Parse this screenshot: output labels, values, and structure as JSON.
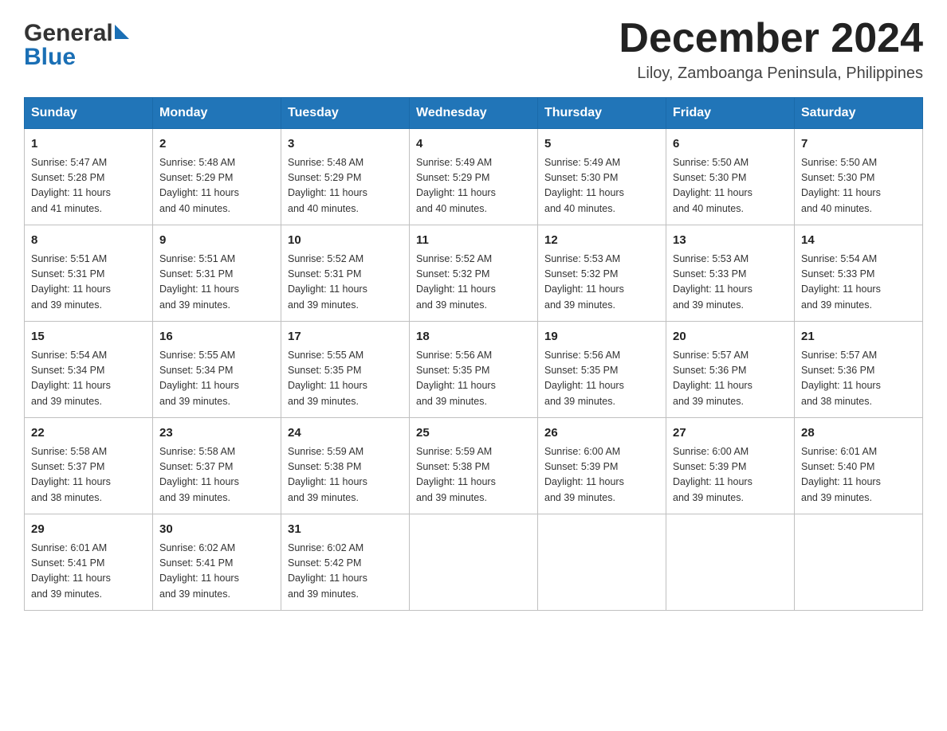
{
  "header": {
    "logo_general": "General",
    "logo_blue": "Blue",
    "month_title": "December 2024",
    "location": "Liloy, Zamboanga Peninsula, Philippines"
  },
  "days_of_week": [
    "Sunday",
    "Monday",
    "Tuesday",
    "Wednesday",
    "Thursday",
    "Friday",
    "Saturday"
  ],
  "weeks": [
    [
      {
        "day": "1",
        "sunrise": "5:47 AM",
        "sunset": "5:28 PM",
        "daylight": "11 hours and 41 minutes."
      },
      {
        "day": "2",
        "sunrise": "5:48 AM",
        "sunset": "5:29 PM",
        "daylight": "11 hours and 40 minutes."
      },
      {
        "day": "3",
        "sunrise": "5:48 AM",
        "sunset": "5:29 PM",
        "daylight": "11 hours and 40 minutes."
      },
      {
        "day": "4",
        "sunrise": "5:49 AM",
        "sunset": "5:29 PM",
        "daylight": "11 hours and 40 minutes."
      },
      {
        "day": "5",
        "sunrise": "5:49 AM",
        "sunset": "5:30 PM",
        "daylight": "11 hours and 40 minutes."
      },
      {
        "day": "6",
        "sunrise": "5:50 AM",
        "sunset": "5:30 PM",
        "daylight": "11 hours and 40 minutes."
      },
      {
        "day": "7",
        "sunrise": "5:50 AM",
        "sunset": "5:30 PM",
        "daylight": "11 hours and 40 minutes."
      }
    ],
    [
      {
        "day": "8",
        "sunrise": "5:51 AM",
        "sunset": "5:31 PM",
        "daylight": "11 hours and 39 minutes."
      },
      {
        "day": "9",
        "sunrise": "5:51 AM",
        "sunset": "5:31 PM",
        "daylight": "11 hours and 39 minutes."
      },
      {
        "day": "10",
        "sunrise": "5:52 AM",
        "sunset": "5:31 PM",
        "daylight": "11 hours and 39 minutes."
      },
      {
        "day": "11",
        "sunrise": "5:52 AM",
        "sunset": "5:32 PM",
        "daylight": "11 hours and 39 minutes."
      },
      {
        "day": "12",
        "sunrise": "5:53 AM",
        "sunset": "5:32 PM",
        "daylight": "11 hours and 39 minutes."
      },
      {
        "day": "13",
        "sunrise": "5:53 AM",
        "sunset": "5:33 PM",
        "daylight": "11 hours and 39 minutes."
      },
      {
        "day": "14",
        "sunrise": "5:54 AM",
        "sunset": "5:33 PM",
        "daylight": "11 hours and 39 minutes."
      }
    ],
    [
      {
        "day": "15",
        "sunrise": "5:54 AM",
        "sunset": "5:34 PM",
        "daylight": "11 hours and 39 minutes."
      },
      {
        "day": "16",
        "sunrise": "5:55 AM",
        "sunset": "5:34 PM",
        "daylight": "11 hours and 39 minutes."
      },
      {
        "day": "17",
        "sunrise": "5:55 AM",
        "sunset": "5:35 PM",
        "daylight": "11 hours and 39 minutes."
      },
      {
        "day": "18",
        "sunrise": "5:56 AM",
        "sunset": "5:35 PM",
        "daylight": "11 hours and 39 minutes."
      },
      {
        "day": "19",
        "sunrise": "5:56 AM",
        "sunset": "5:35 PM",
        "daylight": "11 hours and 39 minutes."
      },
      {
        "day": "20",
        "sunrise": "5:57 AM",
        "sunset": "5:36 PM",
        "daylight": "11 hours and 39 minutes."
      },
      {
        "day": "21",
        "sunrise": "5:57 AM",
        "sunset": "5:36 PM",
        "daylight": "11 hours and 38 minutes."
      }
    ],
    [
      {
        "day": "22",
        "sunrise": "5:58 AM",
        "sunset": "5:37 PM",
        "daylight": "11 hours and 38 minutes."
      },
      {
        "day": "23",
        "sunrise": "5:58 AM",
        "sunset": "5:37 PM",
        "daylight": "11 hours and 39 minutes."
      },
      {
        "day": "24",
        "sunrise": "5:59 AM",
        "sunset": "5:38 PM",
        "daylight": "11 hours and 39 minutes."
      },
      {
        "day": "25",
        "sunrise": "5:59 AM",
        "sunset": "5:38 PM",
        "daylight": "11 hours and 39 minutes."
      },
      {
        "day": "26",
        "sunrise": "6:00 AM",
        "sunset": "5:39 PM",
        "daylight": "11 hours and 39 minutes."
      },
      {
        "day": "27",
        "sunrise": "6:00 AM",
        "sunset": "5:39 PM",
        "daylight": "11 hours and 39 minutes."
      },
      {
        "day": "28",
        "sunrise": "6:01 AM",
        "sunset": "5:40 PM",
        "daylight": "11 hours and 39 minutes."
      }
    ],
    [
      {
        "day": "29",
        "sunrise": "6:01 AM",
        "sunset": "5:41 PM",
        "daylight": "11 hours and 39 minutes."
      },
      {
        "day": "30",
        "sunrise": "6:02 AM",
        "sunset": "5:41 PM",
        "daylight": "11 hours and 39 minutes."
      },
      {
        "day": "31",
        "sunrise": "6:02 AM",
        "sunset": "5:42 PM",
        "daylight": "11 hours and 39 minutes."
      },
      null,
      null,
      null,
      null
    ]
  ],
  "labels": {
    "sunrise": "Sunrise:",
    "sunset": "Sunset:",
    "daylight": "Daylight:"
  }
}
